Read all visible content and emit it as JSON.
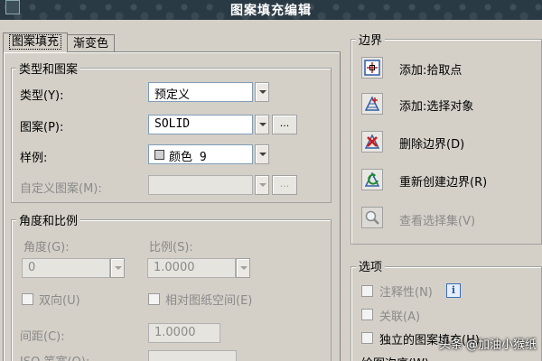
{
  "window": {
    "title": "图案填充编辑"
  },
  "tabs": [
    {
      "label": "图案填充"
    },
    {
      "label": "渐变色"
    }
  ],
  "type_pattern": {
    "legend": "类型和图案",
    "type_label": "类型(Y):",
    "type_value": "预定义",
    "pattern_label": "图案(P):",
    "pattern_value": "SOLID",
    "pattern_browse": "...",
    "swatch_label": "样例:",
    "swatch_value": "颜色 9",
    "custom_label": "自定义图案(M):",
    "custom_browse": "..."
  },
  "angle_scale": {
    "legend": "角度和比例",
    "angle_label": "角度(G):",
    "angle_value": "0",
    "scale_label": "比例(S):",
    "scale_value": "1.0000",
    "double_label": "双向(U)",
    "relative_label": "相对图纸空间(E)",
    "spacing_label": "间距(C):",
    "spacing_value": "1.0000",
    "iso_label": "ISO 笔宽(O):"
  },
  "boundaries": {
    "legend": "边界",
    "items": [
      {
        "label": "添加:拾取点",
        "icon": "pick-points-icon",
        "enabled": true
      },
      {
        "label": "添加:选择对象",
        "icon": "select-objects-icon",
        "enabled": true
      },
      {
        "label": "删除边界(D)",
        "icon": "remove-boundary-icon",
        "enabled": true
      },
      {
        "label": "重新创建边界(R)",
        "icon": "recreate-boundary-icon",
        "enabled": true
      },
      {
        "label": "查看选择集(V)",
        "icon": "view-selection-icon",
        "enabled": false
      }
    ]
  },
  "options": {
    "legend": "选项",
    "annotative_label": "注释性(N)",
    "associative_label": "关联(A)",
    "independent_label": "独立的图案填充(H)",
    "draw_order_label": "绘图次序(W):"
  },
  "watermark": {
    "text": "头条 @加油小猴纸"
  },
  "colors": {
    "face": "#d4d0c8",
    "titlebar": "#2a3a44",
    "swatch": "#d0d0d0"
  }
}
